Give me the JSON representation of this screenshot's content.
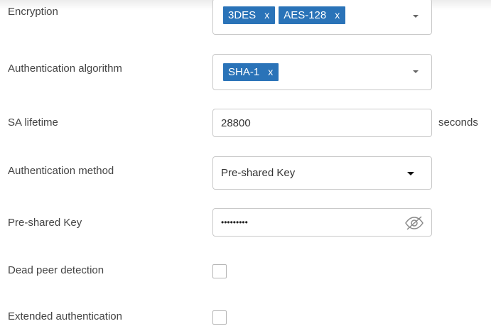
{
  "form": {
    "encryption": {
      "label": "Encryption",
      "tags": [
        "3DES",
        "AES-128"
      ],
      "remove": "x"
    },
    "auth_algorithm": {
      "label": "Authentication algorithm",
      "tags": [
        "SHA-1"
      ],
      "remove": "x"
    },
    "sa_lifetime": {
      "label": "SA lifetime",
      "value": "28800",
      "unit": "seconds"
    },
    "auth_method": {
      "label": "Authentication method",
      "value": "Pre-shared Key"
    },
    "psk": {
      "label": "Pre-shared Key",
      "masked": "•••••••••"
    },
    "dpd": {
      "label": "Dead peer detection",
      "checked": false
    },
    "xauth": {
      "label": "Extended authentication",
      "checked": false
    }
  }
}
